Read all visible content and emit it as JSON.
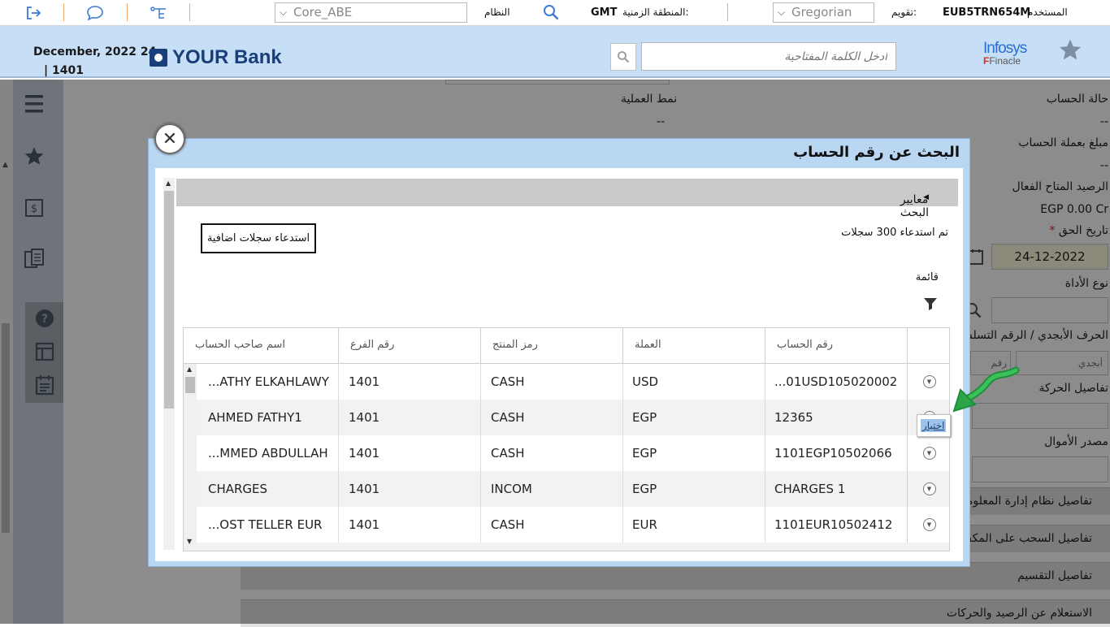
{
  "topbar": {
    "user_label": "المستخدم",
    "user_id": "EUB5TRN654M",
    "calendar_label": "تقويم:",
    "calendar_value": "Gregorian",
    "timezone_label": "المنطقة الزمنية:",
    "timezone_value": "GMT",
    "system_label": "النظام",
    "system_value": "Core_ABE"
  },
  "header": {
    "date_line1": "December, 2022 24",
    "date_line2": "| 1401",
    "bank_name": "YOUR Bank",
    "search_placeholder": "أدخل الكلمة المفتاحية",
    "finacle_line1": "Infosys",
    "finacle_line2": "Finacle"
  },
  "background": {
    "account_status_label": "حالة الحساب",
    "account_status_value": "--",
    "transaction_mode_label": "نمط العملية",
    "transaction_mode_value": "--",
    "amount_acct_currency_label": "مبلغ بعملة الحساب",
    "amount_acct_currency_value": "--",
    "effective_balance_label": "الرصيد المتاح الفعال",
    "effective_balance_value": "EGP 0.00 Cr",
    "due_date_label": "تاريخ الحق",
    "due_date_value": "24-12-2022",
    "instrument_type_label": "نوع الأداة",
    "alpha_serial_label": "الحرف الأبجدي / الرقم التسلسلي",
    "alpha_placeholder": "أبجدي",
    "serial_placeholder": "رقم",
    "transaction_details_label": "تفاصيل الحركة",
    "funds_source_label": "مصدر الأموال",
    "sections": [
      "تفاصيل نظام إدارة المعلومات",
      "تفاصيل السحب على المكشوف",
      "تفاصيل التقسيم",
      "الاستعلام عن الرصيد والحركات"
    ]
  },
  "modal": {
    "title": "البحث عن رقم الحساب",
    "criteria_label": "معايير البحث",
    "retrieve_button": "استدعاء سجلات اضافية",
    "records_text": "تم استدعاء 300 سجلات",
    "list_label": "قائمة",
    "columns": {
      "account_no": "رقم الحساب",
      "currency": "العملة",
      "product_code": "رمز المنتج",
      "branch_no": "رقم الفرع",
      "holder_name": "اسم صاحب الحساب"
    },
    "rows": [
      {
        "account_no": "...01USD105020002",
        "currency": "USD",
        "product_code": "CASH",
        "branch_no": "1401",
        "holder_name": "...ATHY ELKAHLAWY"
      },
      {
        "account_no": "12365",
        "currency": "EGP",
        "product_code": "CASH",
        "branch_no": "1401",
        "holder_name": "AHMED FATHY1"
      },
      {
        "account_no": "1101EGP10502066",
        "currency": "EGP",
        "product_code": "CASH",
        "branch_no": "1401",
        "holder_name": "...MMED ABDULLAH"
      },
      {
        "account_no": "CHARGES 1",
        "currency": "EGP",
        "product_code": "INCOM",
        "branch_no": "1401",
        "holder_name": "CHARGES"
      },
      {
        "account_no": "1101EUR10502412",
        "currency": "EUR",
        "product_code": "CASH",
        "branch_no": "1401",
        "holder_name": "...OST TELLER EUR"
      }
    ],
    "tooltip": "اختيار"
  }
}
